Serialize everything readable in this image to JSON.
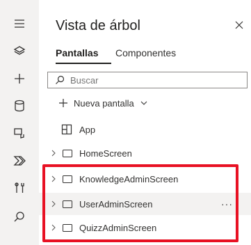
{
  "rail": {
    "icons": [
      "hamburger-icon",
      "layers-icon",
      "plus-icon",
      "database-icon",
      "media-icon",
      "power-automate-icon",
      "tools-icon",
      "search-icon"
    ]
  },
  "panel": {
    "title": "Vista de árbol",
    "tabs": [
      {
        "label": "Pantallas",
        "active": true
      },
      {
        "label": "Componentes",
        "active": false
      }
    ],
    "search": {
      "placeholder": "Buscar",
      "value": ""
    },
    "new_screen_label": "Nueva pantalla",
    "app_label": "App",
    "screens": [
      {
        "label": "HomeScreen"
      },
      {
        "label": "KnowledgeAdminScreen"
      },
      {
        "label": "UserAdminScreen",
        "hover": true,
        "more": "···"
      },
      {
        "label": "QuizzAdminScreen"
      }
    ]
  },
  "highlight_color": "#e81123"
}
